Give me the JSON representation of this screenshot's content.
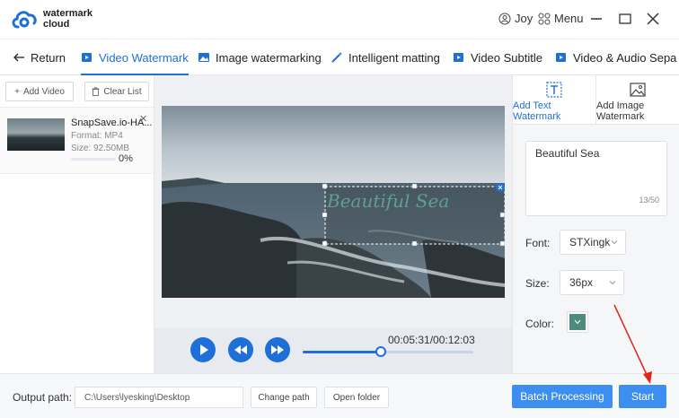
{
  "app": {
    "logo_line1": "watermark",
    "logo_line2": "cloud",
    "user_name": "Joy",
    "menu_label": "Menu",
    "accent": "#1f6fd9"
  },
  "tabs": [
    {
      "label": "Return",
      "icon": "arrow-left-icon"
    },
    {
      "label": "Video Watermark",
      "icon": "video-icon",
      "active": true
    },
    {
      "label": "Image watermarking",
      "icon": "image-icon"
    },
    {
      "label": "Intelligent matting",
      "icon": "magic-wand-icon"
    },
    {
      "label": "Video Subtitle",
      "icon": "video-icon"
    },
    {
      "label": "Video & Audio Sepa",
      "icon": "video-icon"
    }
  ],
  "file_list": {
    "add_label": "Add Video",
    "clear_label": "Clear List",
    "items": [
      {
        "name": "SnapSave.io-HA...",
        "format": "Format:  MP4",
        "size": "Size:  92.50MB",
        "progress": "0%"
      }
    ]
  },
  "player": {
    "time": "00:05:31/00:12:03",
    "position_fraction": 0.46,
    "watermark_text": "Beautiful Sea"
  },
  "settings": {
    "tab_text_line1": "Add Text",
    "tab_text_line2": "Watermark",
    "tab_image_line1": "Add Image",
    "tab_image_line2": "Watermark",
    "text_value": "Beautiful Sea",
    "counter": "13/50",
    "font_label": "Font:",
    "font_value": "STXingk",
    "size_label": "Size:",
    "size_value": "36px",
    "color_label": "Color:",
    "color_value": "#4e8a7e"
  },
  "bottom": {
    "output_label": "Output path:",
    "output_value": "C:\\Users\\lyesking\\Desktop",
    "change_path": "Change path",
    "open_folder": "Open folder",
    "batch": "Batch Processing",
    "start": "Start"
  }
}
